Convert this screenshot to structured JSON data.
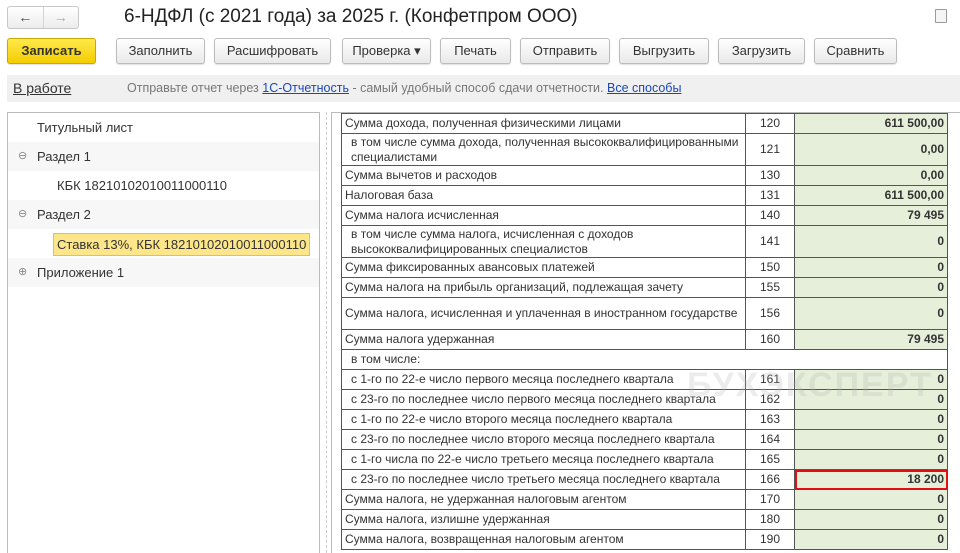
{
  "window": {
    "title": "6-НДФЛ (с 2021 года) за 2025 г. (Конфетпром ООО)",
    "back": "←",
    "forward": "→"
  },
  "toolbar": {
    "save": "Записать",
    "fill": "Заполнить",
    "decode": "Расшифровать",
    "check": "Проверка ▾",
    "print": "Печать",
    "send": "Отправить",
    "export": "Выгрузить",
    "import": "Загрузить",
    "compare": "Сравнить"
  },
  "infobar": {
    "status": "В работе",
    "msg_prefix": "Отправьте отчет через ",
    "link1": "1С-Отчетность",
    "msg_mid": " - самый удобный способ сдачи отчетности. ",
    "link2": "Все способы"
  },
  "tree": [
    {
      "label": "Титульный лист",
      "toggle": ""
    },
    {
      "label": "Раздел 1",
      "toggle": "⊖"
    },
    {
      "label": "КБК 18210102010011000110",
      "toggle": ""
    },
    {
      "label": "Раздел 2",
      "toggle": "⊖"
    },
    {
      "label": "Ставка 13%, КБК 18210102010011000110",
      "toggle": "",
      "selected": true
    },
    {
      "label": "Приложение 1",
      "toggle": "⊕"
    }
  ],
  "watermark": "БУХЭКСПЕРТ",
  "highlight_color": "#e01010",
  "rows": [
    {
      "label": "Сумма дохода, полученная физическими лицами",
      "code": "120",
      "value": "611 500,00"
    },
    {
      "label": "в том числе сумма дохода, полученная высококвалифицированными специалистами",
      "code": "121",
      "value": "0,00",
      "indent": true,
      "tall": true
    },
    {
      "label": "Сумма вычетов и расходов",
      "code": "130",
      "value": "0,00"
    },
    {
      "label": "Налоговая база",
      "code": "131",
      "value": "611 500,00"
    },
    {
      "label": "Сумма налога исчисленная",
      "code": "140",
      "value": "79 495"
    },
    {
      "label": "в том числе сумма налога, исчисленная с доходов высококвалифицированных специалистов",
      "code": "141",
      "value": "0",
      "indent": true,
      "tall": true
    },
    {
      "label": "Сумма фиксированных авансовых платежей",
      "code": "150",
      "value": "0"
    },
    {
      "label": "Сумма налога на прибыль организаций, подлежащая зачету",
      "code": "155",
      "value": "0"
    },
    {
      "label": "Сумма налога, исчисленная и уплаченная в иностранном государстве",
      "code": "156",
      "value": "0",
      "tall": true
    },
    {
      "label": "Сумма налога удержанная",
      "code": "160",
      "value": "79 495"
    },
    {
      "label": "в том числе:",
      "code": null,
      "value": null,
      "indent": true
    },
    {
      "label": "с 1-го по 22-е число первого месяца последнего квартала",
      "code": "161",
      "value": "0",
      "indent": true
    },
    {
      "label": "с 23-го по последнее число первого месяца последнего квартала",
      "code": "162",
      "value": "0",
      "indent": true
    },
    {
      "label": "с 1-го по 22-е число второго месяца последнего квартала",
      "code": "163",
      "value": "0",
      "indent": true
    },
    {
      "label": "с 23-го по последнее число второго месяца последнего квартала",
      "code": "164",
      "value": "0",
      "indent": true
    },
    {
      "label": "с 1-го числа по 22-е число третьего месяца последнего квартала",
      "code": "165",
      "value": "0",
      "indent": true
    },
    {
      "label": "с 23-го по последнее число третьего месяца последнего квартала",
      "code": "166",
      "value": "18 200",
      "indent": true,
      "highlight": true
    },
    {
      "label": "Сумма налога, не удержанная налоговым агентом",
      "code": "170",
      "value": "0"
    },
    {
      "label": "Сумма налога, излишне удержанная",
      "code": "180",
      "value": "0"
    },
    {
      "label": "Сумма налога, возвращенная налоговым агентом",
      "code": "190",
      "value": "0"
    }
  ]
}
